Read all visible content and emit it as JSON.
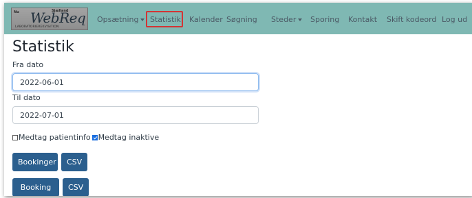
{
  "logo": {
    "brand": "WebReq",
    "top_left": "Nu",
    "top_right": "Sjælland",
    "subtitle": "LABORATORIEREKVISITION"
  },
  "nav": {
    "items": [
      {
        "label": "Opsætning",
        "dropdown": true
      },
      {
        "label": "Statistik",
        "dropdown": false,
        "active": true
      },
      {
        "label": "Kalender",
        "dropdown": false
      },
      {
        "label": "Søgning",
        "dropdown": false
      },
      {
        "label": "Steder",
        "dropdown": true
      },
      {
        "label": "Sporing",
        "dropdown": false
      },
      {
        "label": "Kontakt",
        "dropdown": false
      },
      {
        "label": "Skift kodeord",
        "dropdown": false
      },
      {
        "label": "Log ud",
        "dropdown": false
      }
    ]
  },
  "page": {
    "title": "Statistik",
    "from_label": "Fra dato",
    "from_value": "2022-06-01",
    "to_label": "Til dato",
    "to_value": "2022-07-01",
    "checkbox_patientinfo": {
      "label": "Medtag patientinfo",
      "checked": false
    },
    "checkbox_inactive": {
      "label": "Medtag inaktive",
      "checked": true
    }
  },
  "buttons": {
    "bookinger": "Bookinger",
    "csv1": "CSV",
    "booking_pct": "Booking %",
    "csv2": "CSV"
  },
  "colors": {
    "navbar": "#7fb8b3",
    "button": "#2b5f8e",
    "active_outline": "#d33434"
  }
}
